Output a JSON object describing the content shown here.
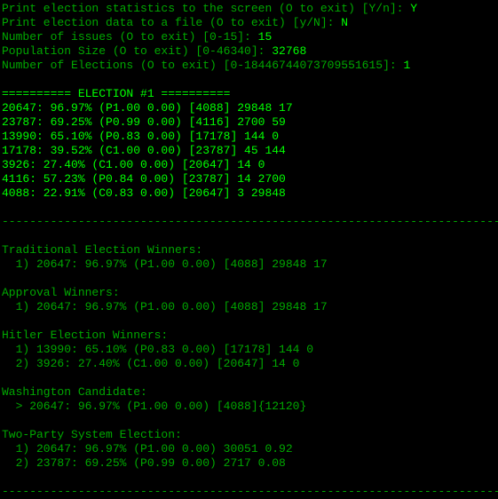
{
  "prompts": {
    "p1_label": "Print election statistics to the screen (O to exit) [Y/n]: ",
    "p1_val": "Y",
    "p2_label": "Print election data to a file (O to exit) [y/N]: ",
    "p2_val": "N",
    "p3_label": "Number of issues (O to exit) [0-15]: ",
    "p3_val": "15",
    "p4_label": "Population Size (O to exit) [0-46340]: ",
    "p4_val": "32768",
    "p5_label": "Number of Elections (O to exit) [0-18446744073709551615]: ",
    "p5_val": "1"
  },
  "header": "========== ELECTION #1 ==========",
  "stats": {
    "s1": "20647: 96.97% (P1.00 0.00) [4088] 29848 17",
    "s2": "23787: 69.25% (P0.99 0.00) [4116] 2700 59",
    "s3": "13990: 65.10% (P0.83 0.00) [17178] 144 0",
    "s4": "17178: 39.52% (C1.00 0.00) [23787] 45 144",
    "s5": "3926: 27.40% (C1.00 0.00) [20647] 14 0",
    "s6": "4116: 57.23% (P0.84 0.00) [23787] 14 2700",
    "s7": "4088: 22.91% (C0.83 0.00) [20647] 3 29848"
  },
  "divider": "------------------------------------------------------------------------",
  "sections": {
    "trad_title": "Traditional Election Winners:",
    "trad_1": "  1) 20647: 96.97% (P1.00 0.00) [4088] 29848 17",
    "approval_title": "Approval Winners:",
    "approval_1": "  1) 20647: 96.97% (P1.00 0.00) [4088] 29848 17",
    "hitler_title": "Hitler Election Winners:",
    "hitler_1": "  1) 13990: 65.10% (P0.83 0.00) [17178] 144 0",
    "hitler_2": "  2) 3926: 27.40% (C1.00 0.00) [20647] 14 0",
    "washington_title": "Washington Candidate:",
    "washington_1": "  > 20647: 96.97% (P1.00 0.00) [4088]{12120}",
    "twoparty_title": "Two-Party System Election:",
    "twoparty_1": "  1) 20647: 96.97% (P1.00 0.00) 30051 0.92",
    "twoparty_2": "  2) 23787: 69.25% (P0.99 0.00) 2717 0.08"
  }
}
